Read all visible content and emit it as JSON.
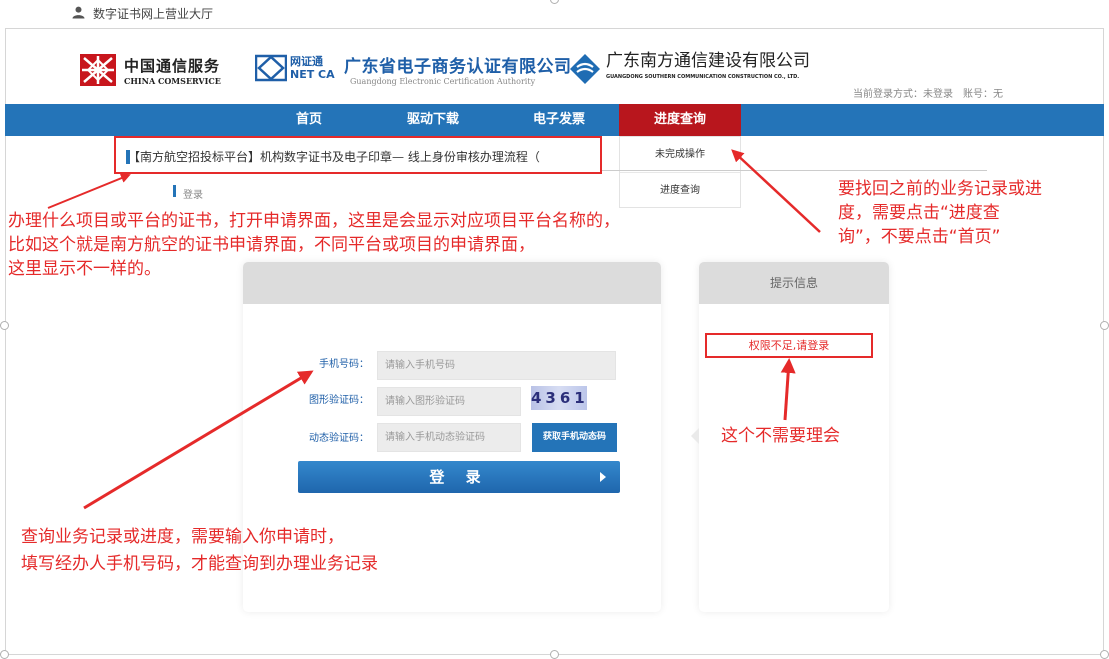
{
  "topbar": {
    "title": "数字证书网上营业大厅",
    "icon": "user-icon"
  },
  "logos": {
    "comservice": {
      "cn": "中国通信服务",
      "en": "CHINA COMSERVICE"
    },
    "netca": {
      "cn": "网证通",
      "en": "NET CA"
    },
    "gdca": {
      "cn": "广东省电子商务认证有限公司",
      "en": "Guangdong Electronic Certification Authority"
    },
    "southern": {
      "cn": "广东南方通信建设有限公司",
      "en": "GUANGDONG SOUTHERN COMMUNICATION CONSTRUCTION CO., LTD."
    }
  },
  "login_status": {
    "text": "当前登录方式：未登录　账号：无"
  },
  "nav": {
    "items": [
      "首页",
      "驱动下载",
      "电子发票",
      "进度查询"
    ],
    "active": 3
  },
  "dropdown": {
    "items": [
      "未完成操作",
      "进度查询"
    ]
  },
  "page_title": "【南方航空招投标平台】机构数字证书及电子印章— 线上身份审核办理流程（",
  "breadcrumb": "登录",
  "form": {
    "phone_label": "手机号码：",
    "phone_placeholder": "请输入手机号码",
    "captcha_label": "图形验证码：",
    "captcha_placeholder": "请输入图形验证码",
    "captcha_text": "4361",
    "sms_label": "动态验证码：",
    "sms_placeholder": "请输入手机动态验证码",
    "sms_button": "获取手机动态码",
    "login_button": "登 录"
  },
  "side": {
    "title": "提示信息",
    "warning": "权限不足,请登录"
  },
  "annotations": {
    "a1": "办理什么项目或平台的证书，打开申请界面，这里是会显示对应项目平台名称的，",
    "a2": "比如这个就是南方航空的证书申请界面，不同平台或项目的申请界面，",
    "a3": "这里显示不一样的。",
    "b1": "要找回之前的业务记录或进",
    "b2": "度，需要点击“进度查",
    "b3": "询”，不要点击“首页”",
    "c1": "这个不需要理会",
    "d1": "查询业务记录或进度，需要输入你申请时，",
    "d2": "填写经办人手机号码，才能查询到办理业务记录"
  },
  "colors": {
    "nav_blue": "#2474b8",
    "active_red": "#b8161d",
    "annotation_red": "#e52a2a"
  }
}
